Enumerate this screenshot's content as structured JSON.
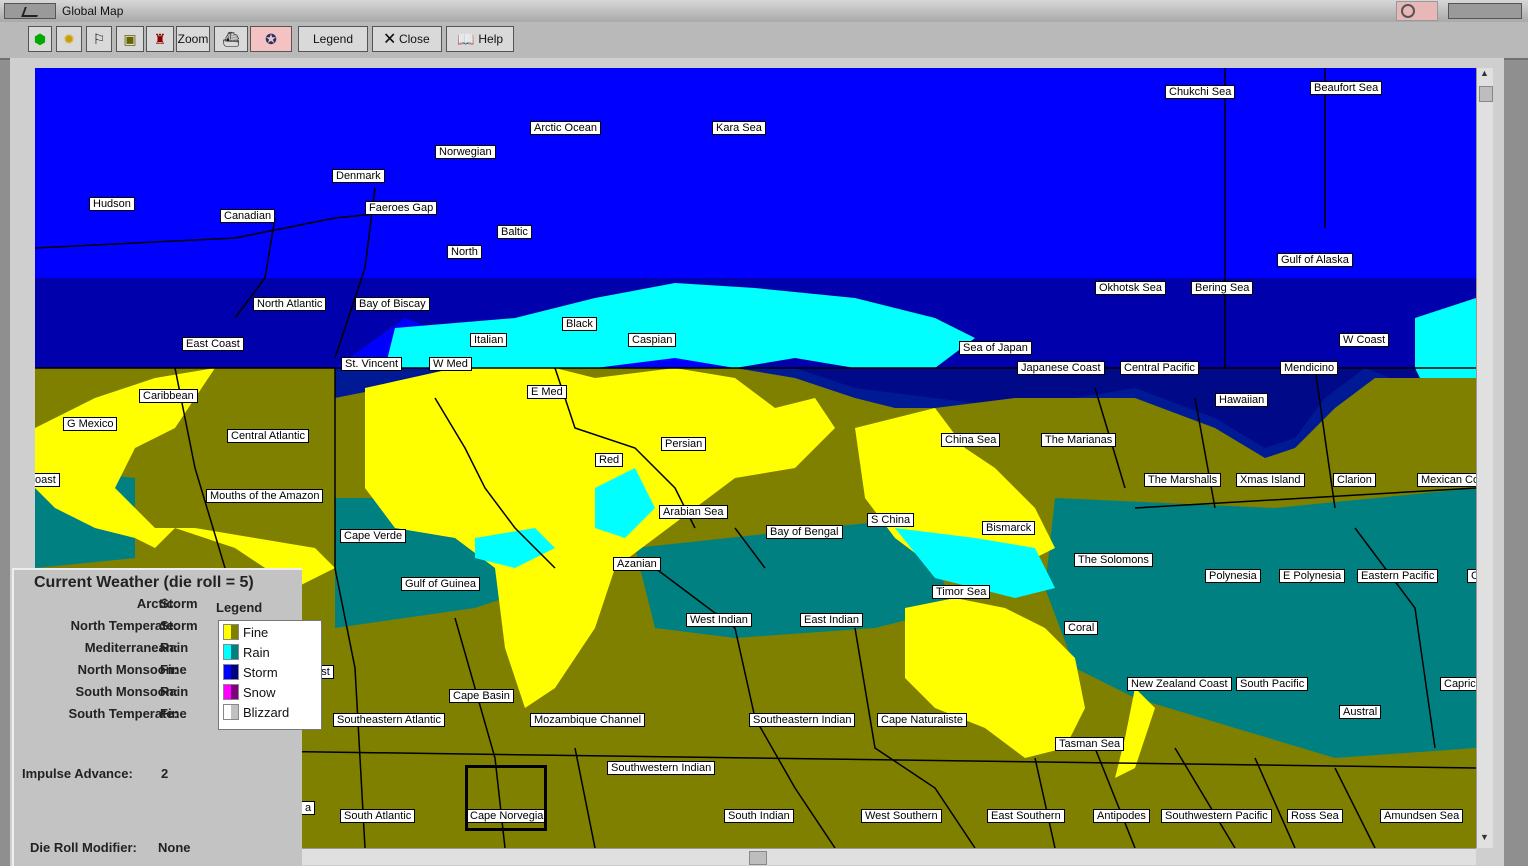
{
  "window": {
    "title": "Global Map"
  },
  "toolbar": {
    "zoom_label": "Zoom",
    "legend_label": "Legend",
    "close_label": "Close",
    "help_label": "Help"
  },
  "weather": {
    "title": "Current Weather (die roll = 5)",
    "rows": [
      {
        "zone": "Arctic:",
        "value": "Storm"
      },
      {
        "zone": "North Temperate:",
        "value": "Storm"
      },
      {
        "zone": "Mediterranean:",
        "value": "Rain"
      },
      {
        "zone": "North Monsoon:",
        "value": "Fine"
      },
      {
        "zone": "South Monsoon:",
        "value": "Rain"
      },
      {
        "zone": "South Temperate:",
        "value": "Fine"
      }
    ],
    "impulse": {
      "label": "Impulse Advance:",
      "value": "2"
    },
    "modifier": {
      "label": "Die Roll Modifier:",
      "value": "None"
    }
  },
  "legend": {
    "title": "Legend",
    "items": [
      {
        "label": "Fine",
        "c1": "#ffff00",
        "c2": "#7f7f00"
      },
      {
        "label": "Rain",
        "c1": "#00ffff",
        "c2": "#008080"
      },
      {
        "label": "Storm",
        "c1": "#0000ff",
        "c2": "#00007f"
      },
      {
        "label": "Snow",
        "c1": "#ff00ff",
        "c2": "#800080"
      },
      {
        "label": "Blizzard",
        "c1": "#ffffff",
        "c2": "#c0c0c0"
      }
    ]
  },
  "sea_areas": [
    "Chukchi Sea",
    "Beaufort Sea",
    "Arctic Ocean",
    "Kara Sea",
    "Norwegian",
    "Denmark",
    "Hudson",
    "Canadian",
    "Faeroes Gap",
    "Baltic",
    "North",
    "Gulf of Alaska",
    "Okhotsk Sea",
    "Bering Sea",
    "North Atlantic",
    "Bay of Biscay",
    "Black",
    "Caspian",
    "Italian",
    "East Coast",
    "Sea of Japan",
    "W Coast",
    "St. Vincent",
    "W Med",
    "Japanese Coast",
    "Central Pacific",
    "Mendicino",
    "E Med",
    "Caribbean",
    "Hawaiian",
    "G Mexico",
    "Central Atlantic",
    "China Sea",
    "The Marianas",
    "Persian",
    "Red",
    "The Marshalls",
    "Xmas Island",
    "Clarion",
    "Mexican Co",
    "oast",
    "Mouths of the Amazon",
    "Arabian Sea",
    "S China",
    "Bismarck",
    "Cape Verde",
    "Bay of Bengal",
    "The Solomons",
    "Azanian",
    "Polynesia",
    "E Polynesia",
    "Eastern Pacific",
    "C",
    "Gulf of Guinea",
    "Timor Sea",
    "West Indian",
    "East Indian",
    "Coral",
    "New Zealand Coast",
    "South Pacific",
    "Capric",
    "Cape Basin",
    "Austral",
    "Southeastern Atlantic",
    "Mozambique Channel",
    "Southeastern Indian",
    "Cape Naturaliste",
    "Tasman Sea",
    "Southwestern Indian",
    "South Atlantic",
    "Cape Norvegia",
    "South Indian",
    "West Southern",
    "East Southern",
    "Antipodes",
    "Southwestern Pacific",
    "Ross Sea",
    "Amundsen Sea",
    "oast",
    "a"
  ],
  "colors": {
    "storm": "#0000ff",
    "storm_dark": "#00007f",
    "rain": "#00ffff",
    "rain_dark": "#008080",
    "fine": "#ffff00",
    "fine_dark": "#7f7f00"
  }
}
